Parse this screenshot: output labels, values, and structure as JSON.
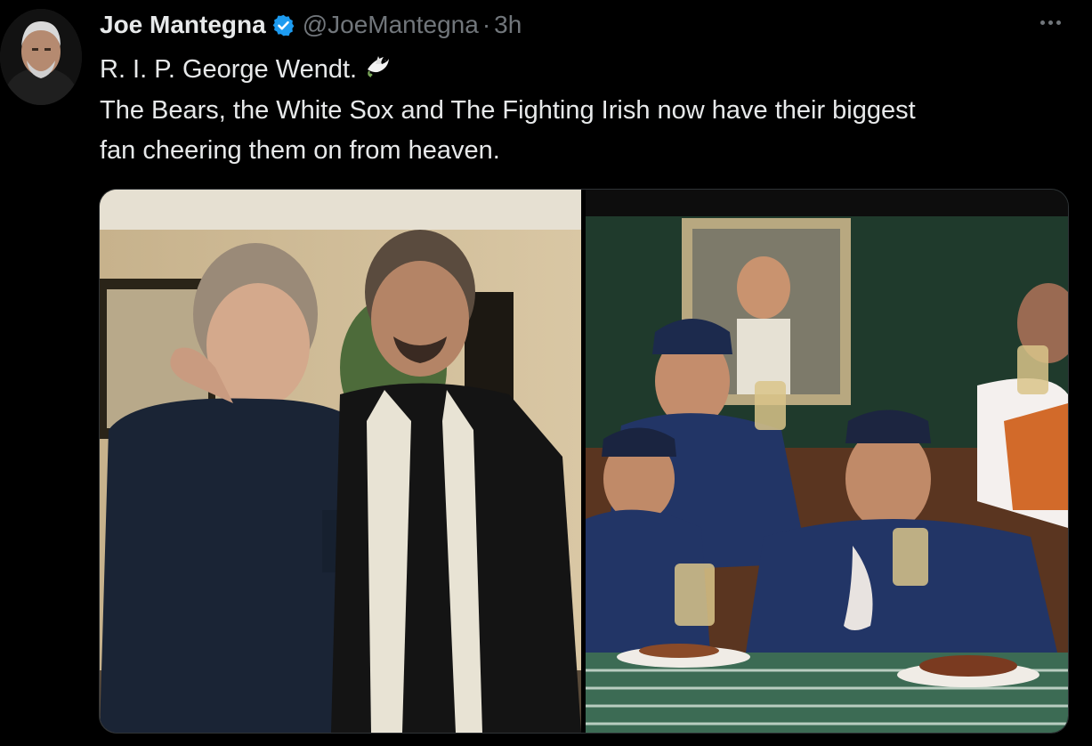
{
  "tweet": {
    "display_name": "Joe Mantegna",
    "handle": "@JoeMantegna",
    "separator": "·",
    "time": "3h",
    "lines": [
      "R. I. P. George Wendt.",
      "The Bears, the White Sox and The Fighting Irish now have their biggest",
      "fan cheering them on from heaven."
    ]
  },
  "icons": {
    "verified": "verified-badge-icon",
    "more": "more-options-icon",
    "dove": "dove-emoji-icon"
  },
  "colors": {
    "background": "#000000",
    "text_primary": "#e7e9ea",
    "text_secondary": "#71767b",
    "verified_blue": "#1d9bf0"
  }
}
